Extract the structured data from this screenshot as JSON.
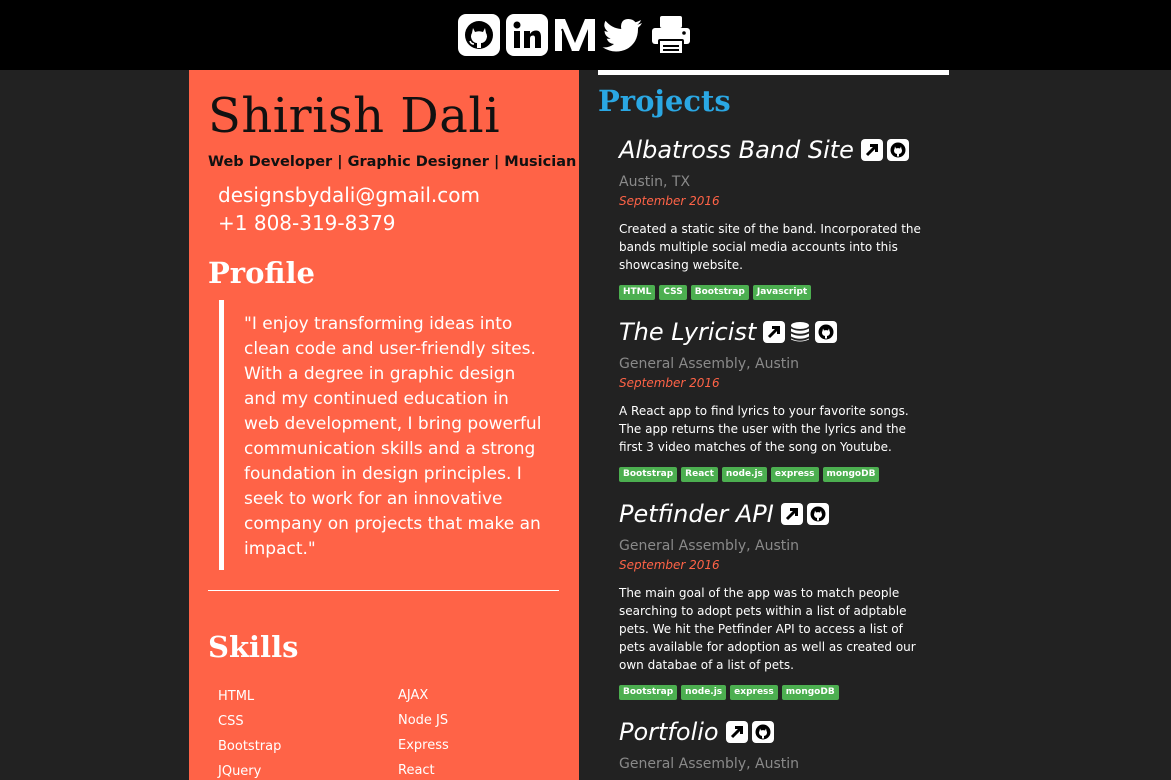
{
  "social": [
    {
      "icon": "github-icon"
    },
    {
      "icon": "linkedin-icon"
    },
    {
      "icon": "medium-icon"
    },
    {
      "icon": "twitter-icon"
    },
    {
      "icon": "print-icon"
    }
  ],
  "resume": {
    "name": "Shirish Dali",
    "tagline": "Web Developer | Graphic Designer | Musician",
    "email": "designsbydali@gmail.com",
    "phone": "+1 808-319-8379",
    "profile_heading": "Profile",
    "profile_quote": "\"I enjoy transforming ideas into clean code and user-friendly sites. With a degree in graphic design and my continued education in web development, I bring powerful communication skills and a strong foundation in design principles. I seek to work for an innovative company on projects that make an impact.\"",
    "skills_heading": "Skills",
    "skills_col1": [
      "HTML",
      "CSS",
      "Bootstrap",
      "JQuery"
    ],
    "skills_col2": [
      "AJAX",
      "Node JS",
      "Express",
      "React"
    ]
  },
  "projects": {
    "heading": "Projects",
    "items": [
      {
        "title": "Albatross Band Site",
        "icons": [
          "external-link-icon",
          "github-icon"
        ],
        "location": "Austin, TX",
        "date": "September 2016",
        "description": "Created a static site of the band. Incorporated the bands multiple social media accounts into this showcasing website.",
        "tags": [
          "HTML",
          "CSS",
          "Bootstrap",
          "Javascript"
        ]
      },
      {
        "title": "The Lyricist",
        "icons": [
          "external-link-icon",
          "database-icon",
          "github-icon"
        ],
        "location": "General Assembly, Austin",
        "date": "September 2016",
        "description": "A React app to find lyrics to your favorite songs. The app returns the user with the lyrics and the first 3 video matches of the song on Youtube.",
        "tags": [
          "Bootstrap",
          "React",
          "node.js",
          "express",
          "mongoDB"
        ]
      },
      {
        "title": "Petfinder API",
        "icons": [
          "external-link-icon",
          "github-icon"
        ],
        "location": "General Assembly, Austin",
        "date": "September 2016",
        "description": "The main goal of the app was to match people searching to adopt pets within a list of adptable pets. We hit the Petfinder API to access a list of pets available for adoption as well as created our own databae of a list of pets.",
        "tags": [
          "Bootstrap",
          "node.js",
          "express",
          "mongoDB"
        ]
      },
      {
        "title": "Portfolio",
        "icons": [
          "external-link-icon",
          "github-icon"
        ],
        "location": "General Assembly, Austin",
        "date": "",
        "description": "",
        "tags": []
      }
    ]
  },
  "colors": {
    "accent": "#FF6347",
    "projects_heading": "#2AA7E3",
    "tag": "#4CAF50",
    "background": "#222222",
    "topbar": "#000000"
  }
}
